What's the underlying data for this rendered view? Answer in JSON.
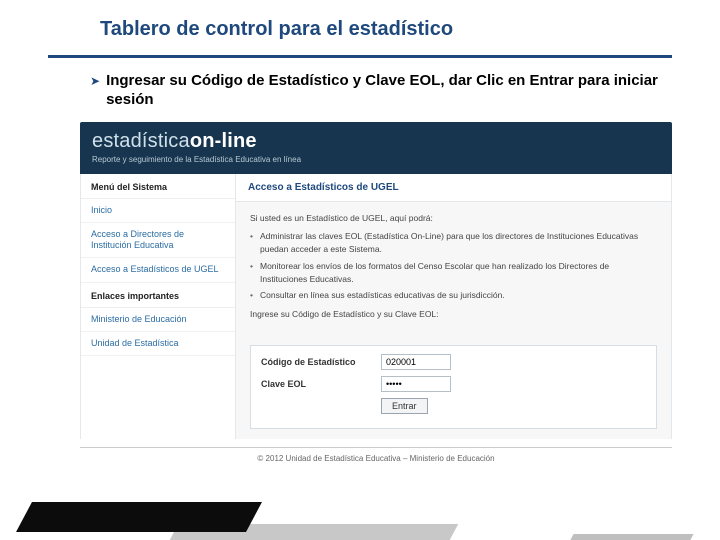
{
  "slide": {
    "title": "Tablero de control para el estadístico",
    "instruction": "Ingresar su Código de Estadístico y Clave EOL, dar Clic en Entrar para iniciar sesión"
  },
  "brand": {
    "line1a": "estadística",
    "line1b": "on-line",
    "sub": "Reporte y seguimiento de la Estadística Educativa en línea"
  },
  "sidebar": {
    "head1": "Menú del Sistema",
    "items1": [
      "Inicio",
      "Acceso a Directores de Institución Educativa",
      "Acceso a Estadísticos de UGEL"
    ],
    "head2": "Enlaces importantes",
    "items2": [
      "Ministerio de Educación",
      "Unidad de Estadística"
    ]
  },
  "panel": {
    "title": "Acceso a Estadísticos de UGEL",
    "intro": "Si usted es un Estadístico de UGEL, aquí podrá:",
    "bullets": [
      "Administrar las claves EOL (Estadística On-Line) para que los directores de Instituciones Educativas puedan acceder a este Sistema.",
      "Monitorear los envíos de los formatos del Censo Escolar que han realizado los Directores de Instituciones Educativas.",
      "Consultar en línea sus estadísticas educativas de su jurisdicción."
    ],
    "prompt": "Ingrese su Código de Estadístico y su Clave EOL:"
  },
  "form": {
    "label_code": "Código de Estadístico",
    "value_code": "020001",
    "label_key": "Clave EOL",
    "value_key": "•••••",
    "submit": "Entrar"
  },
  "footer": {
    "copyright": "© 2012 Unidad de Estadística Educativa – Ministerio de Educación"
  }
}
